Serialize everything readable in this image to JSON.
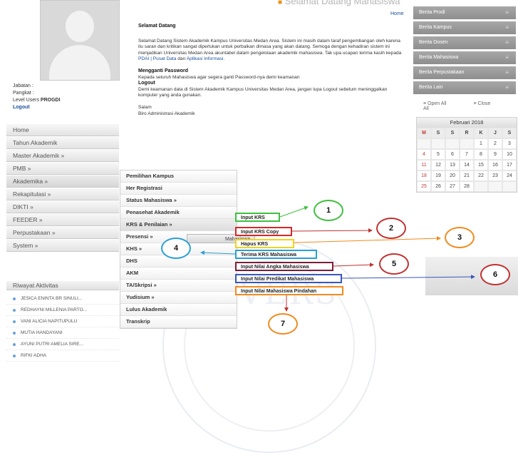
{
  "banner": {
    "title": "Selamat Datang Mahasiswa",
    "home_link": "Home"
  },
  "user": {
    "jabatan_label": "Jabatan",
    "pangkat_label": "Pangkat",
    "level_label": "Level Users",
    "level_value": "PROGDI",
    "logout": "Logout"
  },
  "menu": [
    "Home",
    "Tahun Akademik",
    "Master Akademik »",
    "PMB »",
    "Akademika »",
    "Rekapitulasi »",
    "DIKTI »",
    "FEEDER »",
    "Perpustakaan »",
    "System »"
  ],
  "riwayat": {
    "title": "Riwayat Aktivitas",
    "items": [
      "JESICA ENINTA BR SINULI...",
      "REDHAYNI MILLENIA PARTO...",
      "VANI ALICIA NAPITUPULU",
      "MUTIA HANDAYANI",
      "AYUNI PUTRI AMELIA SIRE...",
      "RIFKI ADHA"
    ]
  },
  "welcome": {
    "heading": "Selamat Datang",
    "body": "Selamat Datang Sistem Akademik Kampus Universitas Medan Area. Sistem ini masih dalam taraf pengembangan oleh karena itu saran dan kritikan sangat diperlukan untuk perbaikan dimasa yang akan datang. Semoga dengan kehadiran sistem ini menjadikan Universitas Medan Area akuntabel dalam pengelolaan akademik mahasiswa. Tak upa ucapan terima kasih kepada",
    "link1": "PDAI | Pusat Data",
    "dan": "dan",
    "link2": "Aplikasi Informasi.",
    "pw_heading": "Mengganti Password",
    "pw_body": "Kepada seluruh Mahasiswa agar segera ganti Password-nya demi keamanan",
    "logout_heading": "Logout",
    "logout_body": "Demi keamanan data di Sistem Akademik Kampus Universitas Medan Area, jangan lupa Logout sebelum meninggalkan komputer yang anda gunakan.",
    "salam": "Salam",
    "sign": "Biro Administrasi Akademik"
  },
  "news": [
    "Berita Prodi",
    "Berita Kampus",
    "Berita Dosen",
    "Berita Mahasiswa",
    "Berita Perpustakaan",
    "Berita Lain"
  ],
  "open_all": "Open All",
  "close_all": "Close All",
  "calendar": {
    "title": "Februari 2018",
    "headers": [
      "M",
      "S",
      "S",
      "R",
      "K",
      "J",
      "S"
    ],
    "rows": [
      [
        "",
        "",
        "",
        "",
        "1",
        "2",
        "3"
      ],
      [
        "4",
        "5",
        "6",
        "7",
        "8",
        "9",
        "10"
      ],
      [
        "11",
        "12",
        "13",
        "14",
        "15",
        "16",
        "17"
      ],
      [
        "18",
        "19",
        "20",
        "21",
        "22",
        "23",
        "24"
      ],
      [
        "25",
        "26",
        "27",
        "28",
        "",
        "",
        ""
      ]
    ]
  },
  "submenu": [
    "Pemilihan Kampus",
    "Her Registrasi",
    "Status Mahasiswa »",
    "Penasehat Akademik",
    "KRS & Penilaian »",
    "Presensi »",
    "KHS »",
    "DHS",
    "AKM",
    "TA/Skripsi »",
    "Yudisium »",
    "Lulus Akademik",
    "Transkrip"
  ],
  "presensi_tip": "Mahasiswa",
  "krs_items": [
    "Input KRS",
    "Input KRS Copy",
    "Hapus KRS",
    "Terima KRS Mahasiswa",
    "Input Nilai Angka Mahasiswa",
    "Input Nilai Predikat Mahasiswa",
    "Input Nilai Mahasiswa Pindahan"
  ],
  "callouts": [
    "1",
    "2",
    "3",
    "4",
    "5",
    "6",
    "7"
  ],
  "watermark": "NIVERS",
  "colors": {
    "c1": "#3fbf3f",
    "c2": "#d62828",
    "c3": "#f28a1e",
    "c4": "#2a9fd6",
    "c5": "#7a1e3a",
    "c6": "#3b56b8",
    "c7": "#f28a1e",
    "c8": "#c03232",
    "callout_fill": "#ffffff"
  }
}
